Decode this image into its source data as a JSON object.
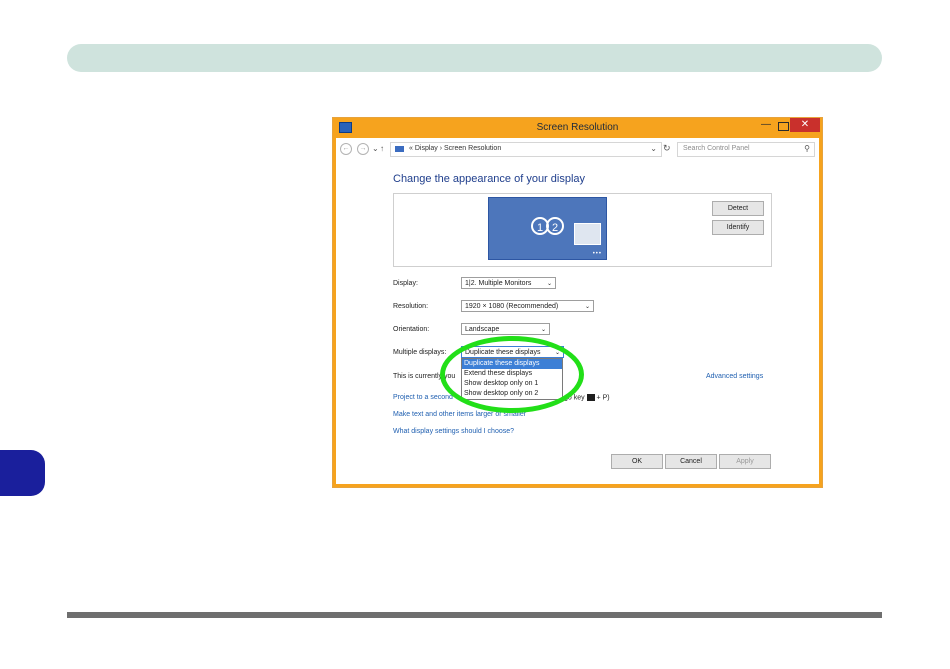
{
  "window": {
    "title": "Screen Resolution",
    "close_glyph": "✕",
    "minimize_glyph": "—"
  },
  "address_bar": {
    "breadcrumb": "« Display › Screen Resolution",
    "search_placeholder": "Search Control Panel"
  },
  "main": {
    "heading": "Change the appearance of your display",
    "detect_label": "Detect",
    "identify_label": "Identify",
    "monitor_numbers": [
      "1",
      "2"
    ],
    "display_label": "Display:",
    "display_value": "1|2. Multiple Monitors",
    "resolution_label": "Resolution:",
    "resolution_value": "1920 × 1080 (Recommended)",
    "orientation_label": "Orientation:",
    "orientation_value": "Landscape",
    "multiple_displays_label": "Multiple displays:",
    "multiple_displays_value": "Duplicate these displays",
    "multiple_displays_options": [
      "Duplicate these displays",
      "Extend these displays",
      "Show desktop only on 1",
      "Show desktop only on 2"
    ],
    "current_text": "This is currently you",
    "advanced_link": "Advanced settings",
    "project_link": "Project to a second",
    "project_suffix": "go key",
    "project_tail": "+ P)",
    "make_text_link": "Make text and other items larger or smaller",
    "what_settings_link": "What display settings should I choose?"
  },
  "footer": {
    "ok_label": "OK",
    "cancel_label": "Cancel",
    "apply_label": "Apply"
  },
  "colors": {
    "title_bar": "#f6a31e",
    "close_button": "#c9302c",
    "highlight_ring": "#22df18",
    "link": "#1f5fb0",
    "selected_option": "#3c7fd6"
  }
}
